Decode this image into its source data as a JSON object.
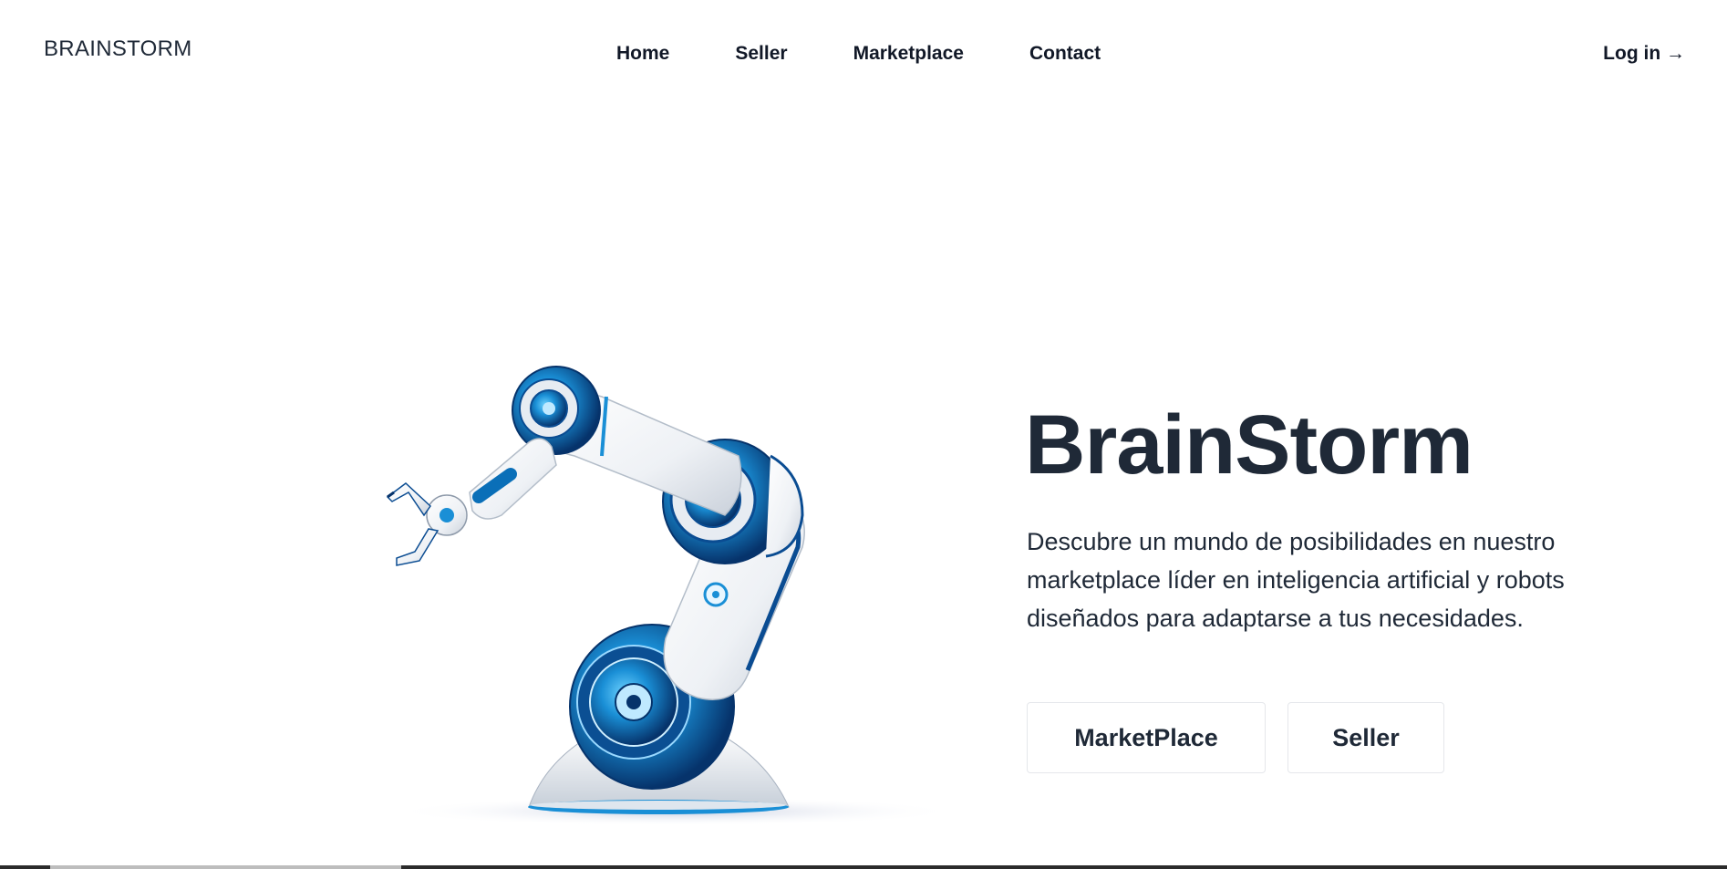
{
  "header": {
    "brand": "BRAINSTORM",
    "nav": [
      {
        "label": "Home"
      },
      {
        "label": "Seller"
      },
      {
        "label": "Marketplace"
      },
      {
        "label": "Contact"
      }
    ],
    "login": "Log in →"
  },
  "hero": {
    "title": "BrainStorm",
    "description": "Descubre un mundo de posibilidades en nuestro marketplace líder en inteligencia artificial y robots diseñados para adaptarse a tus necesidades.",
    "buttons": {
      "marketplace": "MarketPlace",
      "seller": "Seller"
    },
    "image": "robot-arm-illustration"
  },
  "colors": {
    "text": "#1f2937",
    "accent_blue": "#0a6fb8",
    "border": "#e5e7eb"
  }
}
